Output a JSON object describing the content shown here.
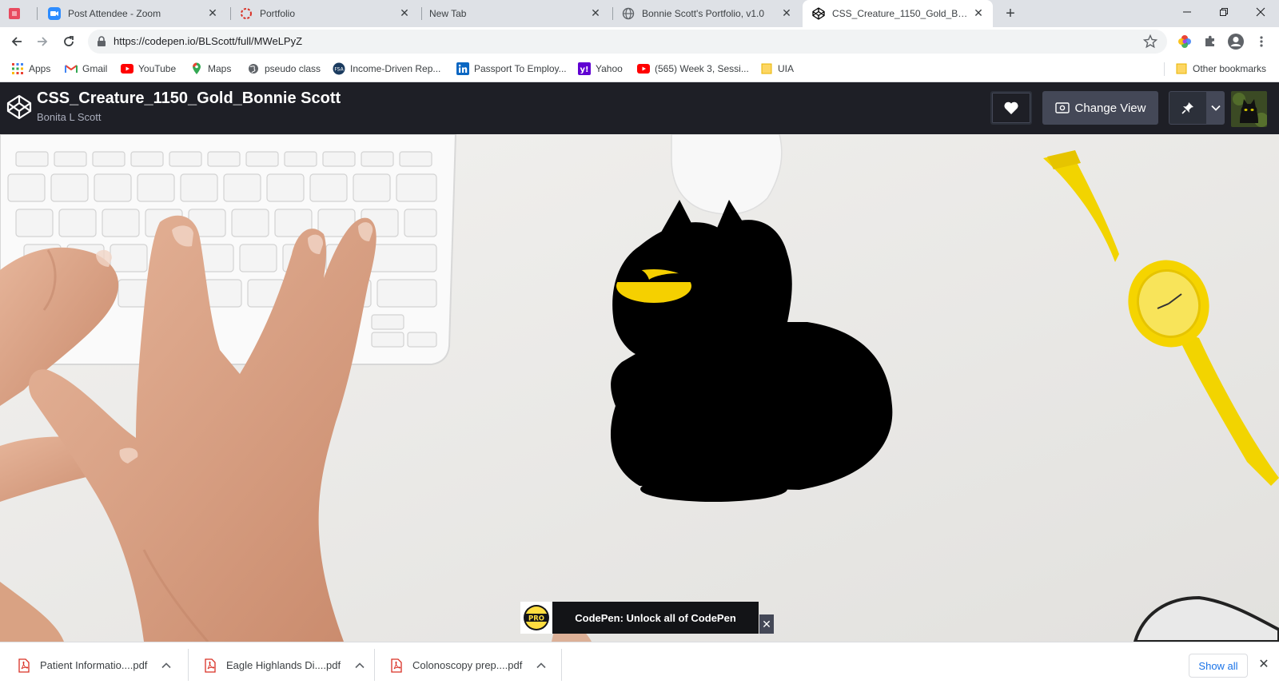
{
  "browser": {
    "tabs": [
      {
        "title": "",
        "favicon": "red-square-icon"
      },
      {
        "title": "Post Attendee - Zoom",
        "favicon": "zoom-camera-icon"
      },
      {
        "title": "Portfolio",
        "favicon": "red-ring-icon"
      },
      {
        "title": "New Tab",
        "favicon": ""
      },
      {
        "title": "Bonnie Scott's Portfolio, v1.0",
        "favicon": "globe-icon"
      },
      {
        "title": "CSS_Creature_1150_Gold_Bonnie Scott",
        "favicon": "codepen-icon",
        "active": true
      }
    ],
    "url": "https://codepen.io/BLScott/full/MWeLPyZ",
    "bookmarks": [
      {
        "label": "Apps",
        "icon": "apps-grid-icon"
      },
      {
        "label": "Gmail",
        "icon": "gmail-icon"
      },
      {
        "label": "YouTube",
        "icon": "youtube-icon"
      },
      {
        "label": "Maps",
        "icon": "maps-pin-icon"
      },
      {
        "label": "pseudo class",
        "icon": "globe-icon"
      },
      {
        "label": "Income-Driven Rep...",
        "icon": "fsa-icon"
      },
      {
        "label": "Passport To Employ...",
        "icon": "linkedin-icon"
      },
      {
        "label": "Yahoo",
        "icon": "yahoo-icon"
      },
      {
        "label": "(565) Week 3, Sessi...",
        "icon": "youtube-icon"
      },
      {
        "label": "UIA",
        "icon": "folder-icon"
      }
    ],
    "other_bookmarks": "Other bookmarks"
  },
  "codepen": {
    "title": "CSS_Creature_1150_Gold_Bonnie Scott",
    "author": "Bonita L Scott",
    "change_view": "Change View",
    "pro_banner": "CodePen: Unlock all of CodePen",
    "pro_badge": "PRO"
  },
  "creature": {
    "body_color": "#000000",
    "eye_color": "#f5d000"
  },
  "downloads": {
    "items": [
      {
        "name": "Patient Informatio....pdf"
      },
      {
        "name": "Eagle Highlands Di....pdf"
      },
      {
        "name": "Colonoscopy prep....pdf"
      }
    ],
    "show_all": "Show all"
  }
}
